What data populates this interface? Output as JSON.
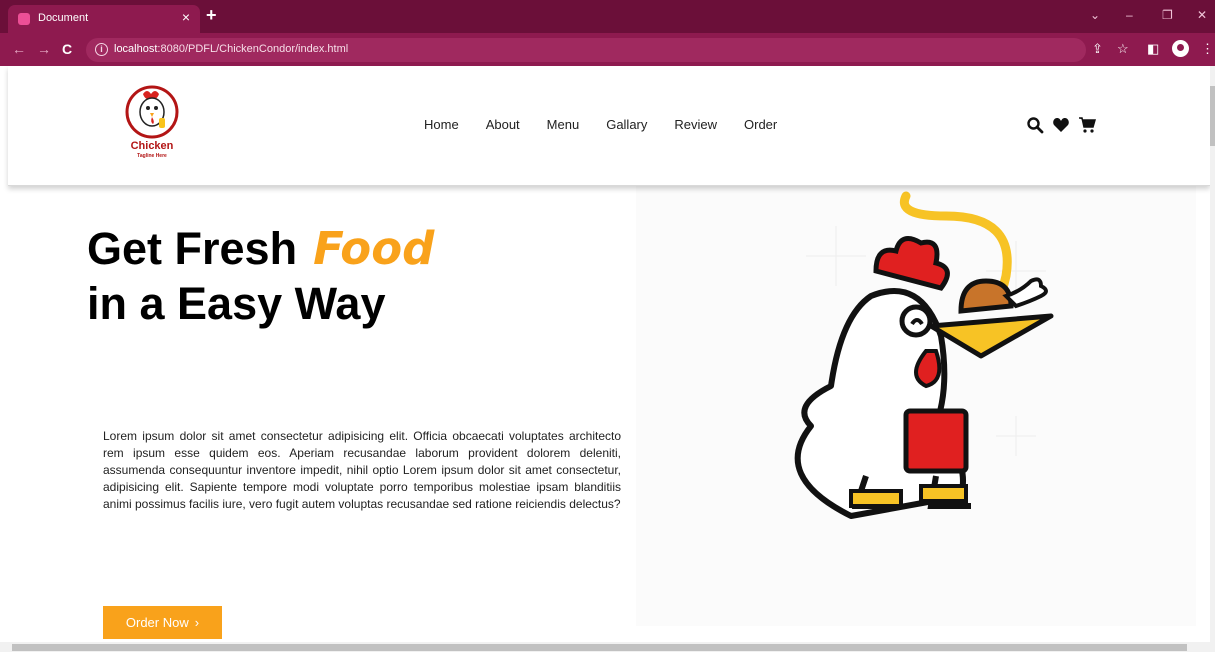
{
  "browser": {
    "tab_title": "Document",
    "url_host": "localhost",
    "url_path": ":8080/PDFL/ChickenCondor/index.html"
  },
  "logo": {
    "name": "Chicken",
    "tagline": "Tagline Here"
  },
  "nav": {
    "items": [
      "Home",
      "About",
      "Menu",
      "Gallary",
      "Review",
      "Order"
    ]
  },
  "header_icons": [
    "search-icon",
    "heart-icon",
    "cart-icon"
  ],
  "hero": {
    "title_line1": "Get Fresh",
    "title_accent": "Food",
    "title_line2": "in a Easy Way",
    "body": "Lorem ipsum dolor sit amet consectetur adipisicing elit. Officia obcaecati voluptates architecto rem ipsum esse quidem eos. Aperiam recusandae laborum provident dolorem deleniti, assumenda consequuntur inventore impedit, nihil optio Lorem ipsum dolor sit amet consectetur, adipisicing elit. Sapiente tempore modi voluptate porro temporibus molestiae ipsam blanditiis animi possimus facilis iure, vero fugit autem voluptas recusandae sed ratione reiciendis delectus?",
    "cta_label": "Order Now"
  },
  "colors": {
    "accent": "#f9a21b",
    "browser_frame": "#8e1a4f",
    "browser_tabbar": "#6b0f39"
  }
}
